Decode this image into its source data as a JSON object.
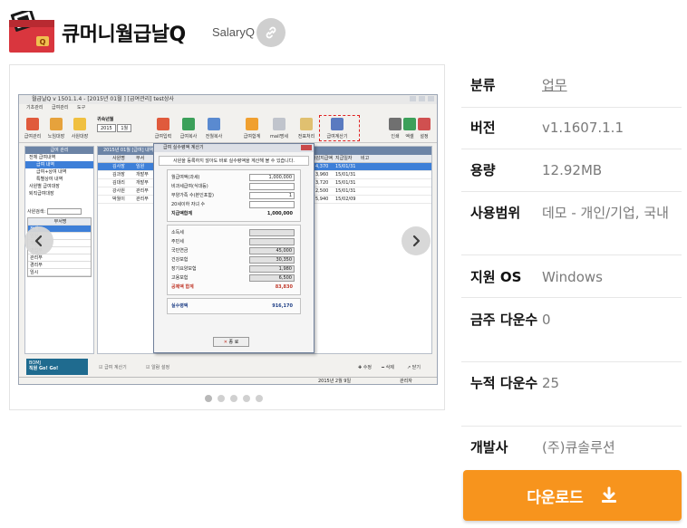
{
  "header": {
    "title": "큐머니월급날Q",
    "subtitle": "SalaryQ",
    "app_icon": "wallet-q-icon",
    "link_icon": "link-icon"
  },
  "screenshot": {
    "window_title": "월급날Q  v 1501.1.4 - [2015년 01월 ] [급여관리] test상사",
    "menu": [
      "기초관리",
      "급여관리",
      "도구"
    ],
    "toolbar": [
      "급여관리",
      "노임대장",
      "사원대장",
      "급여입력",
      "급여복사",
      "전월복사",
      "급여합계",
      "mail명세",
      "전표처리",
      "급여계산기",
      "인쇄",
      "엑셀",
      "설정"
    ],
    "year_label": "귀속년월",
    "year_value": "2015",
    "month_value": "1월",
    "left_panel": {
      "title": "급여 관리",
      "items": [
        "전체 급여내역",
        "급여 내역",
        "급여+상여 내역",
        "특별상여 내역",
        "사원별 급여대장",
        "퇴직급여대장"
      ],
      "dept_search_label": "사원검색:",
      "dept_header": "부서명",
      "departments": [
        "전체",
        "임원",
        "개발부",
        "영업부",
        "관리부",
        "경리부",
        "임시"
      ]
    },
    "grid": {
      "caption": "2015년 01월 [급여] 내역",
      "headers": [
        "사원명",
        "부서",
        "차감지급액",
        "지급일자",
        "비고"
      ],
      "rows": [
        {
          "name": "김사장",
          "dept": "임원",
          "amount": "4,370",
          "date": "15/01/31"
        },
        {
          "name": "김과장",
          "dept": "개발부",
          "amount": "3,960",
          "date": "15/01/31"
        },
        {
          "name": "김대리",
          "dept": "개발부",
          "amount": "3,720",
          "date": "15/01/31"
        },
        {
          "name": "강사원",
          "dept": "관리부",
          "amount": "2,500",
          "date": "15/01/31"
        },
        {
          "name": "박월이",
          "dept": "관리부",
          "amount": "5,940",
          "date": "15/02/09"
        }
      ]
    },
    "dialog": {
      "title": "급여 실수령액 계산기",
      "description": "사원을 등록하지 않아도 바로 실수령액을 계산해 볼 수 있습니다.",
      "inputs": [
        {
          "label": "월급여액(과세)",
          "value": "1,000,000"
        },
        {
          "label": "비과세급여(식대등)",
          "value": ""
        },
        {
          "label": "부양가족 수(본인포함)",
          "value": "1"
        },
        {
          "label": "20세이하 자녀 수",
          "value": ""
        }
      ],
      "gross_label": "지급액합계",
      "gross_value": "1,000,000",
      "deductions": [
        {
          "label": "소득세",
          "value": ""
        },
        {
          "label": "주민세",
          "value": ""
        },
        {
          "label": "국민연금",
          "value": "45,000"
        },
        {
          "label": "건강보험",
          "value": "30,350"
        },
        {
          "label": "장기요양보험",
          "value": "1,980"
        },
        {
          "label": "고용보험",
          "value": "6,500"
        }
      ],
      "deduction_total_label": "공제액 합계",
      "deduction_total_value": "83,830",
      "net_label": "실수령액",
      "net_value": "916,170",
      "close_label": "종 료"
    },
    "status": {
      "badge_line1": "BOMJ",
      "badge_line2": "직원 Go! Go!",
      "check1": "급여 계산기",
      "check2": "알람 설정",
      "actions": [
        "수정",
        "삭제",
        "닫기"
      ],
      "footer_date": "2015년 2월 9일",
      "footer_user": "관리자"
    }
  },
  "carousel": {
    "pages": 5,
    "active_index": 0
  },
  "info": {
    "rows": [
      {
        "label": "분류",
        "value": "업무"
      },
      {
        "label": "버전",
        "value": "v1.1607.1.1"
      },
      {
        "label": "용량",
        "value": "12.92MB"
      },
      {
        "label": "사용범위",
        "value": "데모 - 개인/기업, 국내"
      },
      {
        "label": "지원 OS",
        "value": "Windows"
      },
      {
        "label": "금주 다운수",
        "value": "0"
      },
      {
        "label": "누적 다운수",
        "value": "25"
      },
      {
        "label": "개발사",
        "value": "(주)큐솔루션"
      }
    ]
  },
  "download": {
    "label": "다운로드",
    "icon": "download-icon"
  },
  "colors": {
    "download": "#f7941d",
    "icon_red": "#d9363e",
    "selection_blue": "#3d7fd8"
  }
}
